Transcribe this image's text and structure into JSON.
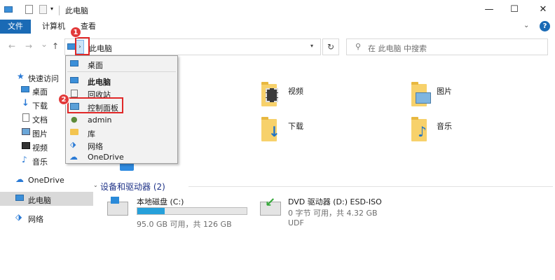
{
  "window": {
    "title": "此电脑",
    "minimize": "—",
    "maximize": "☐",
    "close": "✕"
  },
  "ribbon": {
    "tabs": [
      {
        "label": "文件"
      },
      {
        "label": "计算机"
      },
      {
        "label": "查看"
      }
    ],
    "help": "?"
  },
  "navigation": {
    "back": "←",
    "forward": "→",
    "recent": "⌄",
    "up": "↑"
  },
  "address": {
    "path": "此电脑",
    "refresh": "↻"
  },
  "search": {
    "placeholder": "在 此电脑 中搜索"
  },
  "sidebar": {
    "items": [
      {
        "label": "快速访问",
        "icon": "star-icon"
      },
      {
        "label": "桌面",
        "icon": "desktop-icon"
      },
      {
        "label": "下载",
        "icon": "download-icon"
      },
      {
        "label": "文档",
        "icon": "document-icon"
      },
      {
        "label": "图片",
        "icon": "pictures-icon"
      },
      {
        "label": "视频",
        "icon": "video-icon"
      },
      {
        "label": "音乐",
        "icon": "music-icon"
      },
      {
        "label": "OneDrive",
        "icon": "cloud-icon"
      },
      {
        "label": "此电脑",
        "icon": "computer-icon",
        "selected": true
      },
      {
        "label": "网络",
        "icon": "network-icon"
      }
    ]
  },
  "folders": [
    {
      "label": "视频",
      "icon": "video-folder-icon"
    },
    {
      "label": "图片",
      "icon": "pictures-folder-icon"
    },
    {
      "label": "下载",
      "icon": "download-folder-icon"
    },
    {
      "label": "音乐",
      "icon": "music-folder-icon"
    }
  ],
  "devices": {
    "section_title": "设备和驱动器 (2)",
    "drives": [
      {
        "name": "本地磁盘 (C:)",
        "detail": "95.0 GB 可用，共 126 GB",
        "used_fraction": 0.25,
        "icon": "local-disk-icon"
      },
      {
        "name": "DVD 驱动器 (D:) ESD-ISO",
        "detail": "0 字节 可用，共 4.32 GB",
        "sub": "UDF",
        "icon": "dvd-drive-icon"
      }
    ]
  },
  "dropdown": {
    "items": [
      {
        "label": "桌面",
        "icon": "desktop-icon"
      },
      {
        "label": "此电脑",
        "icon": "computer-icon",
        "bold": true
      },
      {
        "label": "回收站",
        "icon": "recycle-bin-icon"
      },
      {
        "label": "控制面板",
        "icon": "control-panel-icon"
      },
      {
        "label": "admin",
        "icon": "user-icon"
      },
      {
        "label": "库",
        "icon": "library-icon"
      },
      {
        "label": "网络",
        "icon": "network-icon"
      },
      {
        "label": "OneDrive",
        "icon": "cloud-icon"
      }
    ]
  },
  "annotations": {
    "step1": "1",
    "step2": "2"
  },
  "colors": {
    "accent": "#1a6ab5",
    "highlight": "#e02828",
    "section": "#1e3287"
  }
}
